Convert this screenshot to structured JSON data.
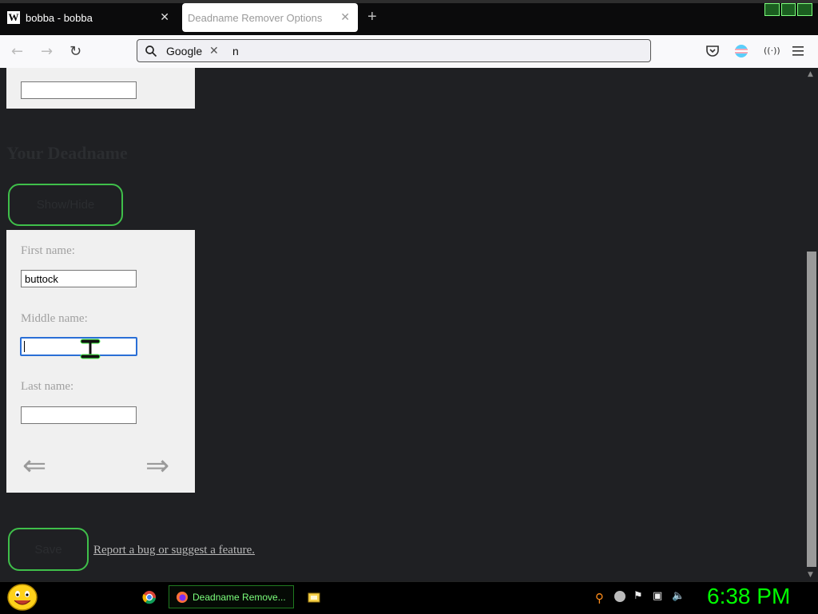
{
  "browser": {
    "tabs": [
      {
        "label": "bobba - bobba",
        "active": false
      },
      {
        "label": "Deadname Remover Options",
        "active": true
      }
    ],
    "new_tab_symbol": "+",
    "url_bar": {
      "search_engine": "Google",
      "query": "n"
    }
  },
  "page": {
    "heading": "Your Deadname",
    "show_hide_label": "Show/Hide",
    "first_name_label": "First name:",
    "first_name_value": "buttock",
    "middle_name_label": "Middle name:",
    "middle_name_value": "",
    "last_name_label": "Last name:",
    "last_name_value": "",
    "prev_arrow": "⇐",
    "next_arrow": "⇒",
    "save_label": "Save",
    "report_link": "Report a bug or suggest a feature."
  },
  "taskbar": {
    "active_task": "Deadname Remove...",
    "clock": "6:38 PM"
  },
  "colors": {
    "accent_green": "#3fbf4a",
    "clock_green": "#00ff00",
    "page_bg": "#1f2023"
  }
}
